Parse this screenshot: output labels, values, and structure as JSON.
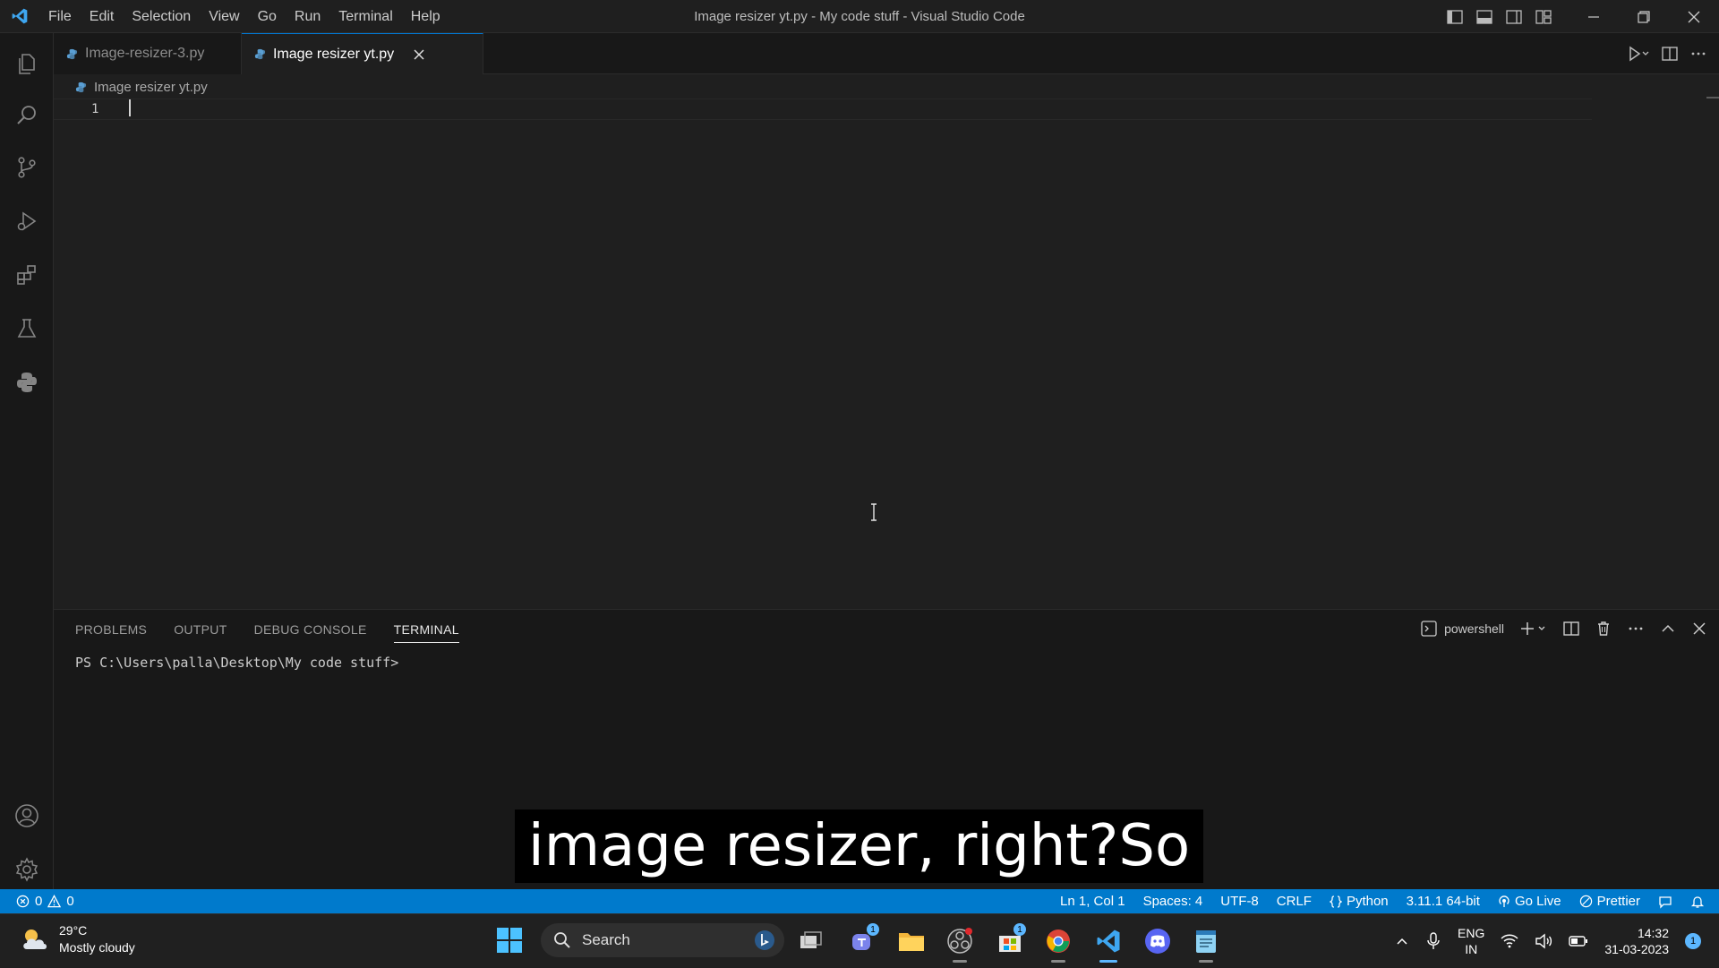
{
  "window": {
    "title": "Image resizer yt.py - My code stuff - Visual Studio Code"
  },
  "menu": [
    "File",
    "Edit",
    "Selection",
    "View",
    "Go",
    "Run",
    "Terminal",
    "Help"
  ],
  "activity_bar": [
    "explorer-icon",
    "search-icon",
    "source-control-icon",
    "run-debug-icon",
    "extensions-icon",
    "testing-icon",
    "python-icon",
    "account-icon",
    "settings-gear-icon"
  ],
  "tabs": [
    {
      "label": "Image-resizer-3.py",
      "active": false
    },
    {
      "label": "Image resizer yt.py",
      "active": true
    }
  ],
  "breadcrumb": {
    "file": "Image resizer yt.py"
  },
  "editor": {
    "line_number": "1"
  },
  "panel": {
    "tabs": [
      "PROBLEMS",
      "OUTPUT",
      "DEBUG CONSOLE",
      "TERMINAL"
    ],
    "active_tab": "TERMINAL",
    "shell": "powershell",
    "prompt": "PS C:\\Users\\palla\\Desktop\\My code stuff>"
  },
  "caption": "image resizer, right?So",
  "statusbar": {
    "errors": "0",
    "warnings": "0",
    "position": "Ln 1, Col 1",
    "spaces": "Spaces: 4",
    "encoding": "UTF-8",
    "eol": "CRLF",
    "language": "Python",
    "interpreter": "3.11.1 64-bit",
    "go_live": "Go Live",
    "prettier": "Prettier"
  },
  "taskbar": {
    "weather_temp": "29°C",
    "weather_desc": "Mostly cloudy",
    "search_label": "Search",
    "teams_badge": "1",
    "store_badge": "1",
    "lang_top": "ENG",
    "lang_bottom": "IN",
    "time": "14:32",
    "date": "31-03-2023",
    "notifications": "1"
  },
  "colors": {
    "accent": "#007acc",
    "editor_bg": "#1f1f1f",
    "sidebar_bg": "#181818",
    "taskbar_bg": "#202020"
  }
}
